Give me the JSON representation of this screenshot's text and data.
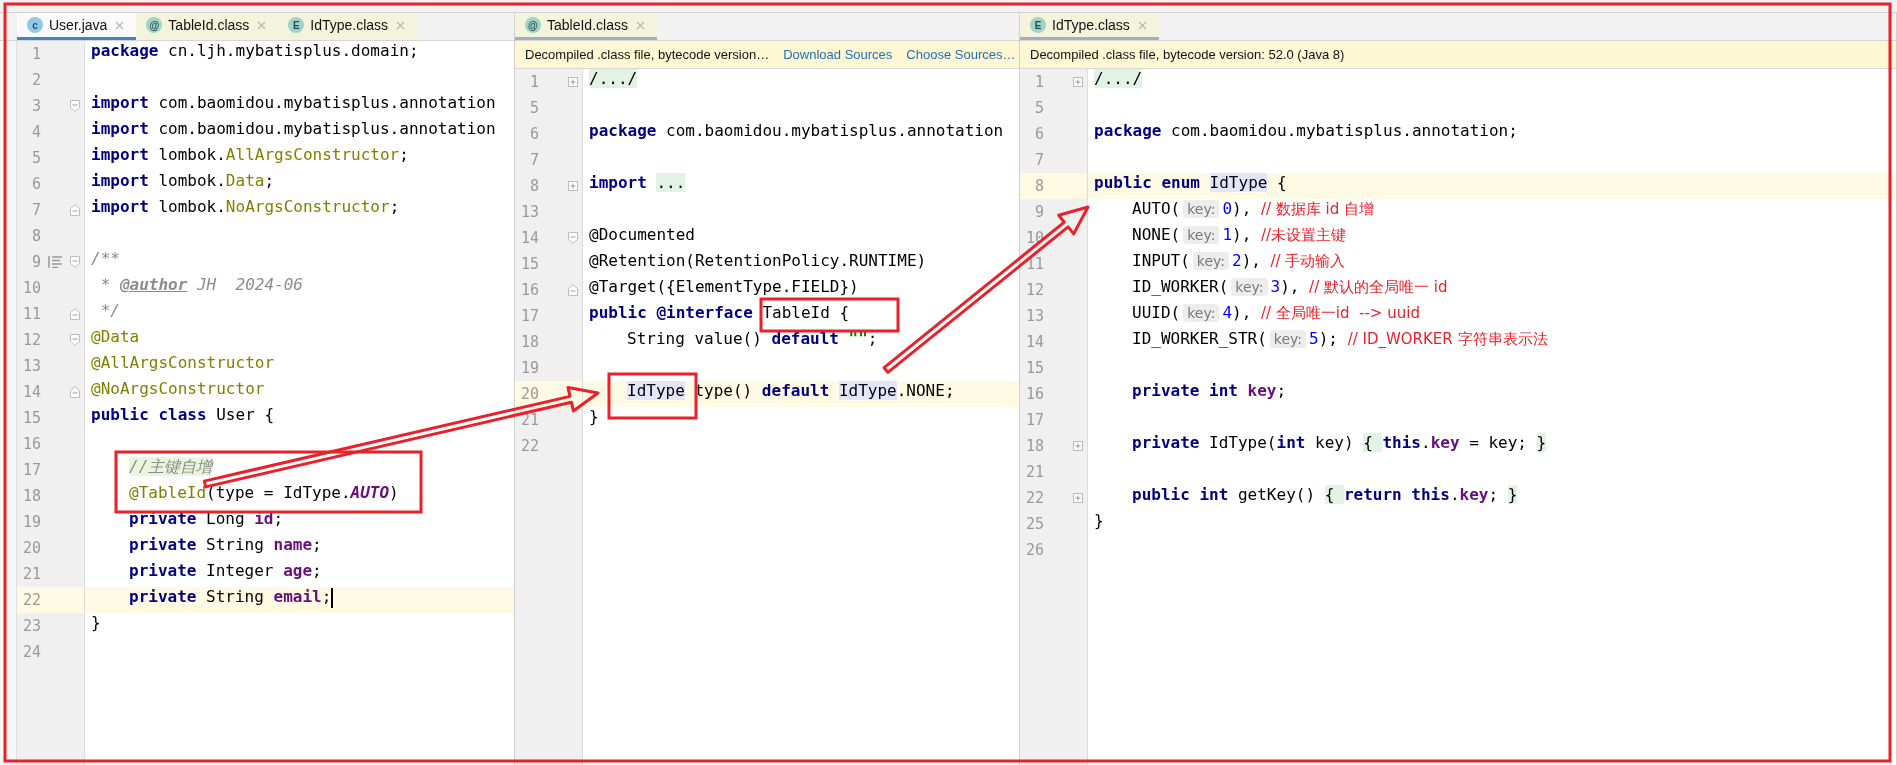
{
  "panes": [
    {
      "focused": true,
      "tabs": [
        {
          "badge": "c",
          "kind": "source",
          "label": "User.java",
          "selected": true
        },
        {
          "badge": "@",
          "kind": "library",
          "label": "TableId.class",
          "selected": false
        },
        {
          "badge": "E",
          "kind": "library",
          "label": "IdType.class",
          "selected": false
        }
      ],
      "lines": [
        {
          "n": "1",
          "current": false,
          "t": [
            {
              "kind": "kw",
              "s": "package"
            },
            {
              "kind": "plain",
              "s": " cn.ljh.mybatisplus.domain;"
            }
          ]
        },
        {
          "n": "2",
          "current": false
        },
        {
          "n": "3",
          "current": false,
          "fold": {
            "kind": "open"
          },
          "t": [
            {
              "kind": "kw",
              "s": "import"
            },
            {
              "kind": "plain",
              "s": " com.baomidou.mybatisplus.annotation"
            }
          ]
        },
        {
          "n": "4",
          "current": false,
          "t": [
            {
              "kind": "kw",
              "s": "import"
            },
            {
              "kind": "plain",
              "s": " com.baomidou.mybatisplus.annotation"
            }
          ]
        },
        {
          "n": "5",
          "current": false,
          "t": [
            {
              "kind": "kw",
              "s": "import"
            },
            {
              "kind": "plain",
              "s": " lombok."
            },
            {
              "kind": "ann",
              "s": "AllArgsConstructor"
            },
            {
              "kind": "plain",
              "s": ";"
            }
          ]
        },
        {
          "n": "6",
          "current": false,
          "t": [
            {
              "kind": "kw",
              "s": "import"
            },
            {
              "kind": "plain",
              "s": " lombok."
            },
            {
              "kind": "ann",
              "s": "Data"
            },
            {
              "kind": "plain",
              "s": ";"
            }
          ]
        },
        {
          "n": "7",
          "current": false,
          "fold": {
            "kind": "close"
          },
          "t": [
            {
              "kind": "kw",
              "s": "import"
            },
            {
              "kind": "plain",
              "s": " lombok."
            },
            {
              "kind": "ann",
              "s": "NoArgsConstructor"
            },
            {
              "kind": "plain",
              "s": ";"
            }
          ]
        },
        {
          "n": "8",
          "current": false
        },
        {
          "n": "9",
          "current": false,
          "fold": {
            "kind": "open"
          },
          "doc": true,
          "t": [
            {
              "kind": "doc",
              "s": "/**"
            }
          ]
        },
        {
          "n": "10",
          "current": false,
          "t": [
            {
              "kind": "doc",
              "s": " * "
            },
            {
              "kind": "doctag",
              "s": "@author"
            },
            {
              "kind": "doc",
              "s": " JH  2024-06"
            }
          ]
        },
        {
          "n": "11",
          "current": false,
          "fold": {
            "kind": "close"
          },
          "t": [
            {
              "kind": "doc",
              "s": " */"
            }
          ]
        },
        {
          "n": "12",
          "current": false,
          "fold": {
            "kind": "open"
          },
          "t": [
            {
              "kind": "ann",
              "s": "@Data"
            }
          ]
        },
        {
          "n": "13",
          "current": false,
          "t": [
            {
              "kind": "ann",
              "s": "@AllArgsConstructor"
            }
          ]
        },
        {
          "n": "14",
          "current": false,
          "fold": {
            "kind": "close"
          },
          "t": [
            {
              "kind": "ann",
              "s": "@NoArgsConstructor"
            }
          ]
        },
        {
          "n": "15",
          "current": false,
          "t": [
            {
              "kind": "kw",
              "s": "public class"
            },
            {
              "kind": "plain",
              "s": " User {"
            }
          ]
        },
        {
          "n": "16",
          "current": false
        },
        {
          "n": "17",
          "current": false,
          "indented": true,
          "t": [
            {
              "kind": "remark",
              "s": "//主键自增"
            }
          ]
        },
        {
          "n": "18",
          "current": false,
          "indented": true,
          "t": [
            {
              "kind": "ann",
              "s": "@TableId"
            },
            {
              "kind": "plain",
              "s": "(type = IdType."
            },
            {
              "kind": "const",
              "s": "AUTO"
            },
            {
              "kind": "plain",
              "s": ")"
            }
          ]
        },
        {
          "n": "19",
          "current": false,
          "indented": true,
          "t": [
            {
              "kind": "kw",
              "s": "private"
            },
            {
              "kind": "plain",
              "s": " Long "
            },
            {
              "kind": "field",
              "s": "id"
            },
            {
              "kind": "plain",
              "s": ";"
            }
          ]
        },
        {
          "n": "20",
          "current": false,
          "indented": true,
          "t": [
            {
              "kind": "kw",
              "s": "private"
            },
            {
              "kind": "plain",
              "s": " String "
            },
            {
              "kind": "field",
              "s": "name"
            },
            {
              "kind": "plain",
              "s": ";"
            }
          ]
        },
        {
          "n": "21",
          "current": false,
          "indented": true,
          "t": [
            {
              "kind": "kw",
              "s": "private"
            },
            {
              "kind": "plain",
              "s": " Integer "
            },
            {
              "kind": "field",
              "s": "age"
            },
            {
              "kind": "plain",
              "s": ";"
            }
          ]
        },
        {
          "n": "22",
          "current": true,
          "caret": true,
          "indented": true,
          "t": [
            {
              "kind": "kw",
              "s": "private"
            },
            {
              "kind": "plain",
              "s": " String "
            },
            {
              "kind": "field",
              "s": "email"
            },
            {
              "kind": "plain",
              "s": ";"
            }
          ]
        },
        {
          "n": "23",
          "current": false,
          "t": [
            {
              "kind": "plain",
              "s": "}"
            }
          ]
        },
        {
          "n": "24",
          "current": false
        }
      ]
    },
    {
      "focused": false,
      "tabs": [
        {
          "badge": "@",
          "kind": "library",
          "label": "TableId.class",
          "selected": true
        }
      ],
      "notice": {
        "text": "Decompiled .class file, bytecode version…",
        "links": [
          "Download Sources",
          "Choose Sources…"
        ]
      },
      "lines": [
        {
          "n": "1",
          "current": false,
          "fold": {
            "kind": "plus"
          },
          "t": [
            {
              "kind": "folded",
              "s": "/.../"
            }
          ]
        },
        {
          "n": "5",
          "current": false
        },
        {
          "n": "6",
          "current": false,
          "t": [
            {
              "kind": "kw",
              "s": "package"
            },
            {
              "kind": "plain",
              "s": " com.baomidou.mybatisplus.annotation"
            }
          ]
        },
        {
          "n": "7",
          "current": false
        },
        {
          "n": "8",
          "current": false,
          "fold": {
            "kind": "plus"
          },
          "t": [
            {
              "kind": "kw",
              "s": "import "
            },
            {
              "kind": "folded",
              "s": "..."
            }
          ]
        },
        {
          "n": "13",
          "current": false
        },
        {
          "n": "14",
          "current": false,
          "fold": {
            "kind": "open"
          },
          "t": [
            {
              "kind": "plain",
              "s": "@Documented"
            }
          ]
        },
        {
          "n": "15",
          "current": false,
          "t": [
            {
              "kind": "plain",
              "s": "@Retention(RetentionPolicy.RUNTIME)"
            }
          ]
        },
        {
          "n": "16",
          "current": false,
          "fold": {
            "kind": "close"
          },
          "t": [
            {
              "kind": "plain",
              "s": "@Target({ElementType.FIELD})"
            }
          ]
        },
        {
          "n": "17",
          "current": false,
          "t": [
            {
              "kind": "kw",
              "s": "public @interface"
            },
            {
              "kind": "plain",
              "s": " TableId {"
            }
          ]
        },
        {
          "n": "18",
          "current": false,
          "indented": true,
          "t": [
            {
              "kind": "plain",
              "s": "String value() "
            },
            {
              "kind": "kw",
              "s": "default"
            },
            {
              "kind": "str",
              "s": " \"\""
            },
            {
              "kind": "plain",
              "s": ";"
            }
          ]
        },
        {
          "n": "19",
          "current": false
        },
        {
          "n": "20",
          "current": true,
          "indented": true,
          "t": [
            {
              "kind": "usage",
              "s": "IdType"
            },
            {
              "kind": "plain",
              "s": " type() "
            },
            {
              "kind": "kw",
              "s": "default "
            },
            {
              "kind": "usage",
              "s": "IdType"
            },
            {
              "kind": "plain",
              "s": ".NONE;"
            }
          ]
        },
        {
          "n": "21",
          "current": false,
          "t": [
            {
              "kind": "plain",
              "s": "}"
            }
          ]
        },
        {
          "n": "22",
          "current": false
        }
      ]
    },
    {
      "focused": false,
      "tabs": [
        {
          "badge": "E",
          "kind": "library",
          "label": "IdType.class",
          "selected": true
        }
      ],
      "notice": {
        "text": "Decompiled .class file, bytecode version: 52.0 (Java 8)"
      },
      "lines": [
        {
          "n": "1",
          "current": false,
          "fold": {
            "kind": "plus"
          },
          "t": [
            {
              "kind": "folded",
              "s": "/.../"
            }
          ]
        },
        {
          "n": "5",
          "current": false
        },
        {
          "n": "6",
          "current": false,
          "t": [
            {
              "kind": "kw",
              "s": "package"
            },
            {
              "kind": "plain",
              "s": " com.baomidou.mybatisplus.annotation;"
            }
          ]
        },
        {
          "n": "7",
          "current": false
        },
        {
          "n": "8",
          "current": true,
          "t": [
            {
              "kind": "kw",
              "s": "public enum "
            },
            {
              "kind": "usage",
              "s": "IdType"
            },
            {
              "kind": "plain",
              "s": " {"
            }
          ]
        },
        {
          "n": "9",
          "current": false,
          "indented": true,
          "t": [
            {
              "kind": "plain",
              "s": "AUTO("
            },
            {
              "kind": "hint",
              "s": "key:"
            },
            {
              "kind": "num",
              "s": "0"
            },
            {
              "kind": "plain",
              "s": "), "
            },
            {
              "kind": "note",
              "s": "// 数据库 id 自增"
            }
          ]
        },
        {
          "n": "10",
          "current": false,
          "indented": true,
          "t": [
            {
              "kind": "plain",
              "s": "NONE("
            },
            {
              "kind": "hint",
              "s": "key:"
            },
            {
              "kind": "num",
              "s": "1"
            },
            {
              "kind": "plain",
              "s": "), "
            },
            {
              "kind": "note",
              "s": "//未设置主键"
            }
          ]
        },
        {
          "n": "11",
          "current": false,
          "indented": true,
          "t": [
            {
              "kind": "plain",
              "s": "INPUT("
            },
            {
              "kind": "hint",
              "s": "key:"
            },
            {
              "kind": "num",
              "s": "2"
            },
            {
              "kind": "plain",
              "s": "), "
            },
            {
              "kind": "note",
              "s": "// 手动输入"
            }
          ]
        },
        {
          "n": "12",
          "current": false,
          "indented": true,
          "t": [
            {
              "kind": "plain",
              "s": "ID_WORKER("
            },
            {
              "kind": "hint",
              "s": "key:"
            },
            {
              "kind": "num",
              "s": "3"
            },
            {
              "kind": "plain",
              "s": "), "
            },
            {
              "kind": "note",
              "s": "// 默认的全局唯一 id"
            }
          ]
        },
        {
          "n": "13",
          "current": false,
          "indented": true,
          "t": [
            {
              "kind": "plain",
              "s": "UUID("
            },
            {
              "kind": "hint",
              "s": "key:"
            },
            {
              "kind": "num",
              "s": "4"
            },
            {
              "kind": "plain",
              "s": "), "
            },
            {
              "kind": "note",
              "s": "// 全局唯一id  --> uuid"
            }
          ]
        },
        {
          "n": "14",
          "current": false,
          "indented": true,
          "t": [
            {
              "kind": "plain",
              "s": "ID_WORKER_STR("
            },
            {
              "kind": "hint",
              "s": "key:"
            },
            {
              "kind": "num",
              "s": "5"
            },
            {
              "kind": "plain",
              "s": "); "
            },
            {
              "kind": "note",
              "s": "// ID_WORKER 字符串表示法"
            }
          ]
        },
        {
          "n": "15",
          "current": false
        },
        {
          "n": "16",
          "current": false,
          "indented": true,
          "t": [
            {
              "kind": "kw",
              "s": "private int "
            },
            {
              "kind": "field",
              "s": "key"
            },
            {
              "kind": "plain",
              "s": ";"
            }
          ]
        },
        {
          "n": "17",
          "current": false
        },
        {
          "n": "18",
          "current": false,
          "fold": {
            "kind": "plus"
          },
          "indented": true,
          "t": [
            {
              "kind": "kw",
              "s": "private"
            },
            {
              "kind": "plain",
              "s": " IdType("
            },
            {
              "kind": "kw",
              "s": "int"
            },
            {
              "kind": "plain",
              "s": " key) "
            },
            {
              "kind": "folded",
              "s": "{ "
            },
            {
              "kind": "kw",
              "s": "this"
            },
            {
              "kind": "plain",
              "s": "."
            },
            {
              "kind": "field",
              "s": "key"
            },
            {
              "kind": "plain",
              "s": " = key; "
            },
            {
              "kind": "folded",
              "s": "}"
            }
          ]
        },
        {
          "n": "21",
          "current": false
        },
        {
          "n": "22",
          "current": false,
          "fold": {
            "kind": "plus"
          },
          "indented": true,
          "t": [
            {
              "kind": "kw",
              "s": "public int"
            },
            {
              "kind": "plain",
              "s": " getKey() "
            },
            {
              "kind": "folded",
              "s": "{ "
            },
            {
              "kind": "kw",
              "s": "return this"
            },
            {
              "kind": "plain",
              "s": "."
            },
            {
              "kind": "field",
              "s": "key"
            },
            {
              "kind": "plain",
              "s": "; "
            },
            {
              "kind": "folded",
              "s": "}"
            }
          ]
        },
        {
          "n": "25",
          "current": false,
          "t": [
            {
              "kind": "plain",
              "s": "}"
            }
          ]
        },
        {
          "n": "26",
          "current": false
        }
      ]
    }
  ]
}
